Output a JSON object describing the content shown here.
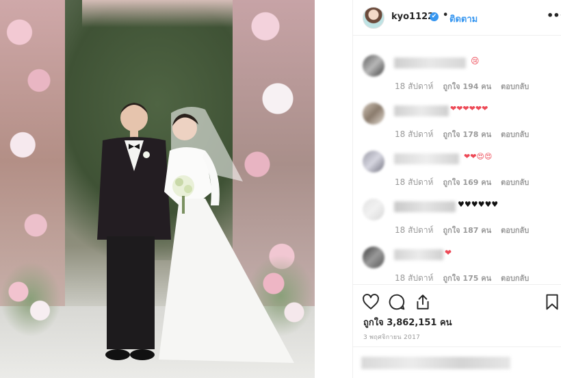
{
  "post": {
    "username": "kyo1122",
    "verified_glyph": "✔",
    "separator": "•",
    "follow_label": "ติดตาม",
    "more_icon": "•••"
  },
  "comments": [
    {
      "text": "😢",
      "time": "18 สัปดาห์",
      "likes": "ถูกใจ 194 คน",
      "reply": "ตอบกลับ"
    },
    {
      "text": "❤❤❤❤❤❤",
      "time": "18 สัปดาห์",
      "likes": "ถูกใจ 178 คน",
      "reply": "ตอบกลับ"
    },
    {
      "text": "❤❤😍😍",
      "time": "18 สัปดาห์",
      "likes": "ถูกใจ 169 คน",
      "reply": "ตอบกลับ"
    },
    {
      "text": "♥♥♥♥♥♥",
      "time": "18 สัปดาห์",
      "likes": "ถูกใจ 187 คน",
      "reply": "ตอบกลับ"
    },
    {
      "text": "❤",
      "time": "18 สัปดาห์",
      "likes": "ถูกใจ 175 คน",
      "reply": "ตอบกลับ"
    }
  ],
  "actions": {
    "icons": [
      "heart-icon",
      "comment-icon",
      "share-icon",
      "bookmark-icon"
    ],
    "likes_total": "ถูกใจ 3,862,151 คน",
    "date": "3 พฤศจิกายน 2017"
  },
  "colors": {
    "link": "#3897f0",
    "heart": "#ed4956",
    "muted": "#999999"
  }
}
